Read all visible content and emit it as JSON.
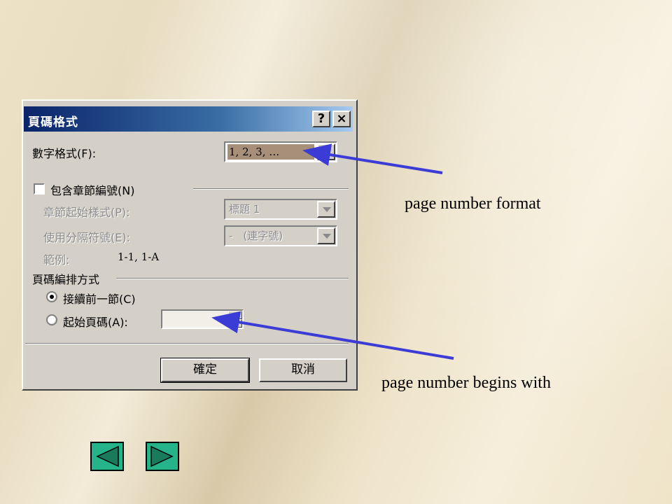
{
  "dialog": {
    "title": "頁碼格式",
    "help_button": "?",
    "close_button": "×",
    "number_format": {
      "label": "數字格式(F):",
      "value": "1, 2, 3, …"
    },
    "include_chapter": {
      "label": "包含章節編號(N)",
      "checked": false
    },
    "chapter_style": {
      "label": "章節起始樣式(P):",
      "value": "標題 1"
    },
    "separator": {
      "label": "使用分隔符號(E):",
      "value": "-　(連字號)"
    },
    "example": {
      "label": "範例:",
      "value": "1-1, 1-A"
    },
    "numbering_group": {
      "label": "頁碼編排方式"
    },
    "continue_option": {
      "label": "接續前一節(C)",
      "selected": true
    },
    "start_at_option": {
      "label": "起始頁碼(A):",
      "selected": false,
      "value": ""
    },
    "ok_label": "確定",
    "cancel_label": "取消"
  },
  "annotations": {
    "format_label": "page number  format",
    "begins_label": "page number  begins with",
    "arrow_color": "#3b3bd6"
  },
  "navigation": {
    "previous_icon": "left-triangle-icon",
    "next_icon": "right-triangle-icon",
    "button_color": "#25b38a"
  }
}
